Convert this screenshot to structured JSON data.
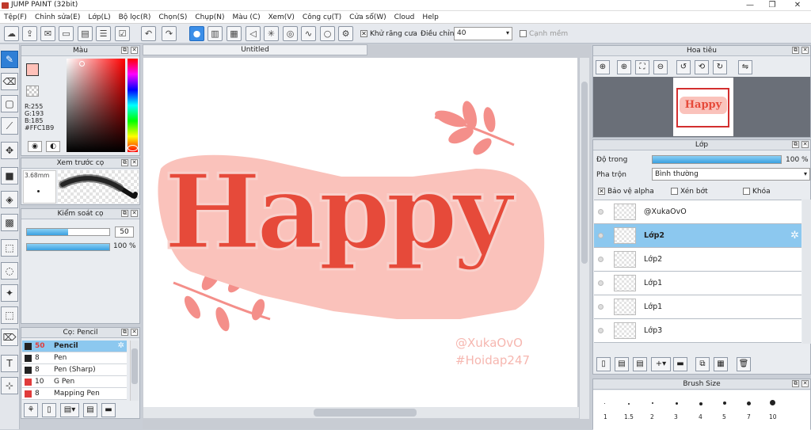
{
  "window": {
    "title": "JUMP PAINT (32bit)",
    "minimize": "—",
    "maximize": "❐",
    "close": "✕"
  },
  "menu": [
    "Tệp(F)",
    "Chỉnh sửa(E)",
    "Lớp(L)",
    "Bộ lọc(R)",
    "Chọn(S)",
    "Chụp(N)",
    "Màu (C)",
    "Xem(V)",
    "Công cụ(T)",
    "Cửa sổ(W)",
    "Cloud",
    "Help"
  ],
  "toolbar": {
    "antialias_label": "Khử răng cưa",
    "adjust_label": "Điều chỉnh",
    "adjust_value": "40",
    "smooth_label": "Cạnh mềm"
  },
  "color_panel": {
    "title": "Màu",
    "r": "R:255",
    "g": "G:193",
    "b": "B:185",
    "hex": "#FFC1B9",
    "current_color": "#FFC1B9"
  },
  "brush_preview": {
    "title": "Xem trước cọ",
    "size": "3.68mm"
  },
  "brush_control": {
    "title": "Kiểm soát cọ",
    "size_value": "50",
    "opacity_value": "100 %",
    "size_fill": 0.5,
    "opacity_fill": 1.0
  },
  "brush_list": {
    "title": "Cọ: Pencil",
    "items": [
      {
        "size": "50",
        "name": "Pencil",
        "color": "#222222"
      },
      {
        "size": "8",
        "name": "Pen",
        "color": "#222222"
      },
      {
        "size": "8",
        "name": "Pen (Sharp)",
        "color": "#222222"
      },
      {
        "size": "10",
        "name": "G Pen",
        "color": "#e03b3b"
      },
      {
        "size": "8",
        "name": "Mapping Pen",
        "color": "#e03b3b"
      }
    ]
  },
  "document": {
    "tab": "Untitled",
    "art_text": "Happy",
    "watermark1": "@XukaOvO",
    "watermark2": "#Hoidap247"
  },
  "navigator": {
    "title": "Hoa tiêu"
  },
  "layers": {
    "title": "Lớp",
    "opacity_label": "Độ trong",
    "opacity_value": "100 %",
    "opacity_fill": 1.0,
    "blend_label": "Pha trộn",
    "blend_value": "Bình thường",
    "protect_alpha": "Bảo vệ alpha",
    "clipping": "Xén bớt",
    "lock": "Khóa",
    "items": [
      {
        "name": "@XukaOvO"
      },
      {
        "name": "Lớp2"
      },
      {
        "name": "Lớp2"
      },
      {
        "name": "Lớp1"
      },
      {
        "name": "Lớp1"
      },
      {
        "name": "Lớp3"
      }
    ]
  },
  "brush_size": {
    "title": "Brush Size",
    "sizes": [
      "1",
      "1.5",
      "2",
      "3",
      "4",
      "5",
      "7",
      "10"
    ]
  }
}
